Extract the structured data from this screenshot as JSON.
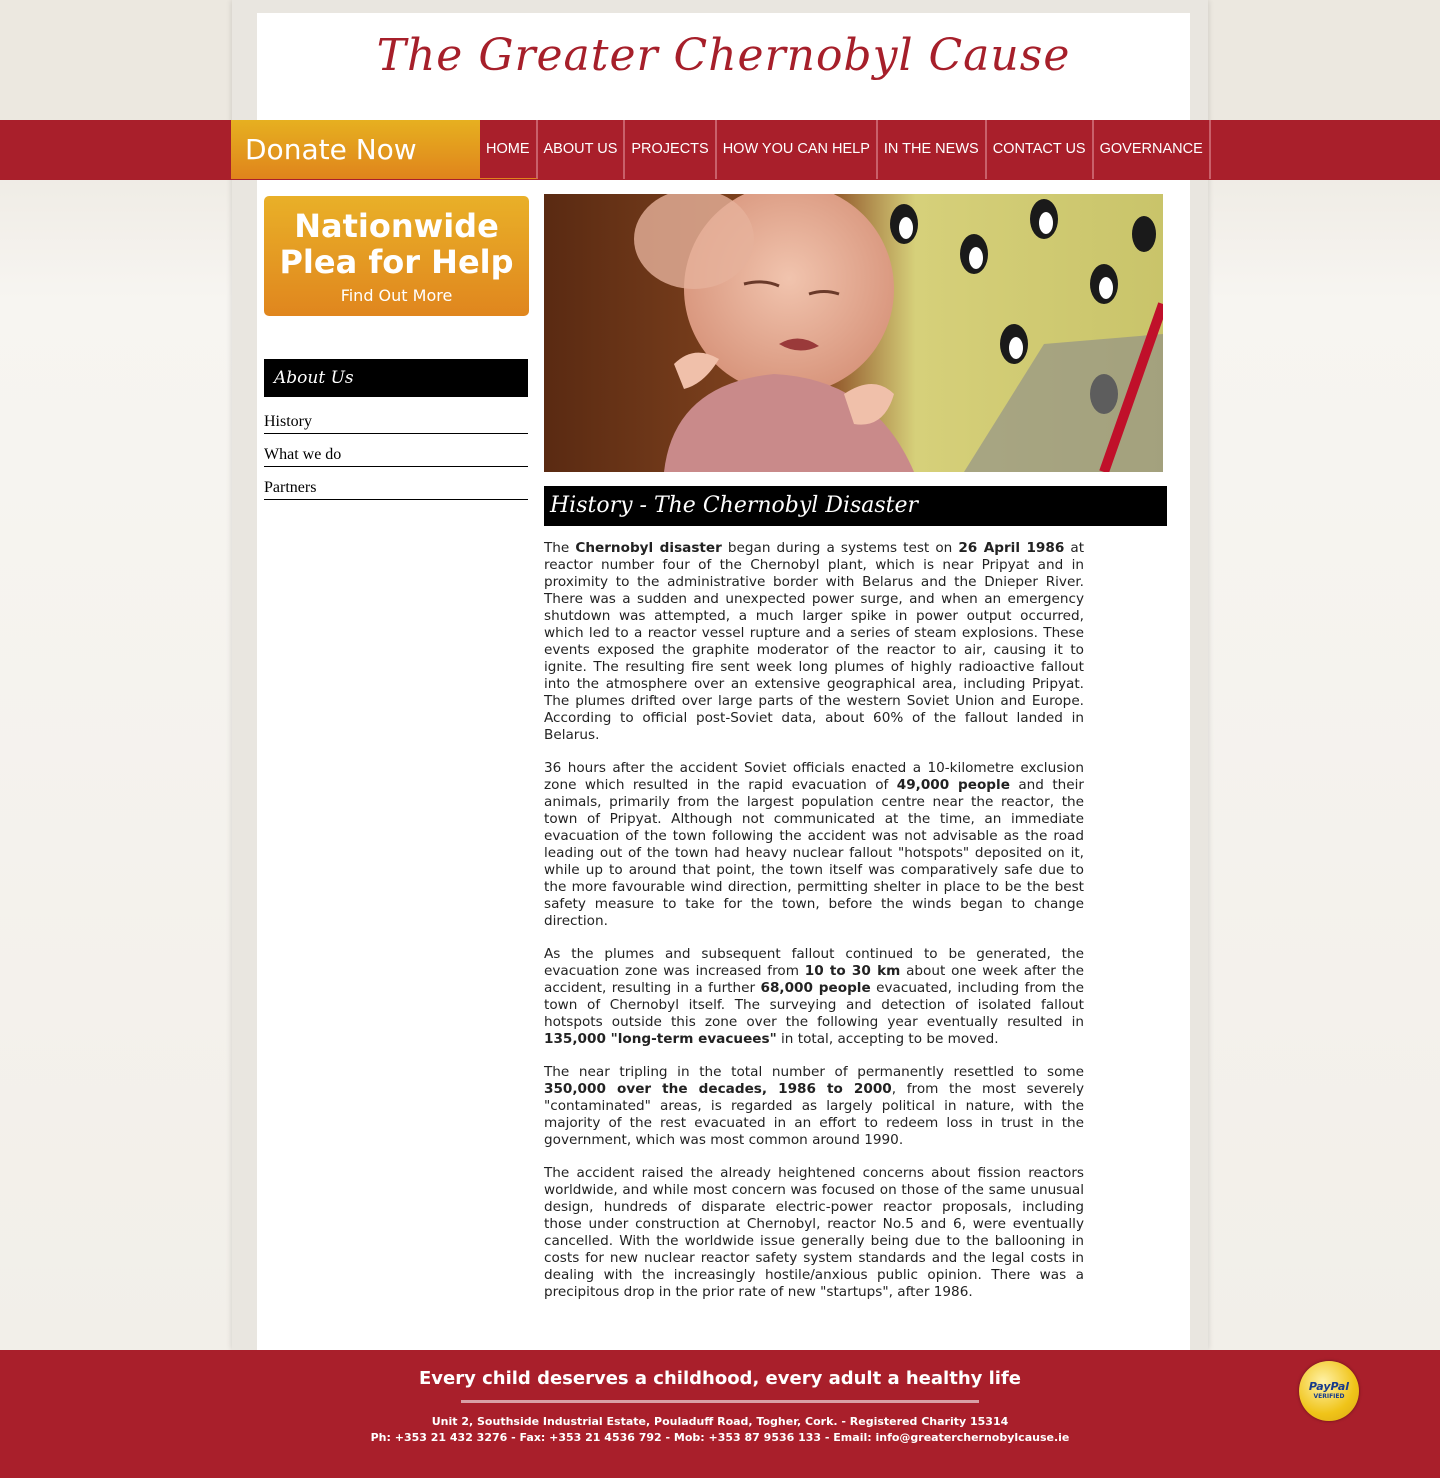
{
  "header": {
    "site_title": "The Greater Chernobyl Cause"
  },
  "nav": {
    "donate_label": "Donate Now",
    "items": [
      {
        "label": "HOME"
      },
      {
        "label": "ABOUT US"
      },
      {
        "label": "PROJECTS"
      },
      {
        "label": "HOW YOU CAN HELP"
      },
      {
        "label": "IN THE NEWS"
      },
      {
        "label": "CONTACT US"
      },
      {
        "label": "GOVERNANCE"
      }
    ]
  },
  "promo": {
    "title_line1": "Nationwide",
    "title_line2": "Plea for Help",
    "subtitle": "Find Out More"
  },
  "sidebar": {
    "header": "About Us",
    "links": [
      {
        "label": "History"
      },
      {
        "label": "What we do"
      },
      {
        "label": "Partners"
      }
    ]
  },
  "main": {
    "section_title": "History - The Chernobyl Disaster",
    "p1": {
      "a": "The ",
      "b1": "Chernobyl disaster",
      "c": " began during a systems test on ",
      "b2": "26 April 1986",
      "d": " at reactor number four of the Chernobyl plant, which is near Pripyat and in proximity to the administrative border with Belarus and the Dnieper River. There was a sudden and unexpected power surge, and when an emergency shutdown was attempted, a much larger spike in power output occurred, which led to a reactor vessel rupture and a series of steam explosions. These events exposed the graphite moderator of the reactor to air, causing it to ignite. The resulting fire sent week long plumes of highly radioactive fallout into the atmosphere over an extensive geographical area, including Pripyat. The plumes drifted over large parts of the western Soviet Union and Europe. According to official post-Soviet data, about 60% of the fallout landed in Belarus."
    },
    "p2": {
      "a": "36 hours after the accident Soviet officials enacted a 10-kilometre exclusion zone which resulted in the rapid evacuation of ",
      "b1": "49,000 people",
      "c": " and their animals, primarily from the largest population centre near the reactor, the town of Pripyat. Although not communicated at the time, an immediate evacuation of the town following the accident was not advisable as the road leading out of the town had heavy nuclear fallout \"hotspots\" deposited on it, while up to around that point, the town itself was comparatively safe due to the more favourable wind direction, permitting shelter in place to be the best safety measure to take for the town, before the winds began to change direction."
    },
    "p3": {
      "a": "As the plumes and subsequent fallout continued to be generated, the evacuation zone was increased from ",
      "b1": "10 to 30 km",
      "c": " about one week after the accident, resulting in a further ",
      "b2": "68,000 people",
      "d": " evacuated, including from the town of Chernobyl itself. The surveying and detection of isolated fallout hotspots outside this zone over the following year eventually resulted in ",
      "b3": "135,000 \"long-term evacuees\"",
      "e": " in total, accepting to be moved."
    },
    "p4": {
      "a": "The near tripling in the total number of permanently resettled to some ",
      "b1": "350,000 over the decades, 1986 to 2000",
      "c": ", from the most severely \"contaminated\" areas, is regarded as largely political in nature, with the majority of the rest evacuated in an effort to redeem loss in trust in the government, which was most common around 1990."
    },
    "p5": "The accident raised the already heightened concerns about fission reactors worldwide, and while most concern was focused on those of the same unusual design, hundreds of disparate electric-power reactor proposals, including those under construction at Chernobyl, reactor No.5 and 6, were eventually cancelled. With the worldwide issue generally being due to the ballooning in costs for new nuclear reactor safety system standards and the legal costs in dealing with the increasingly hostile/anxious public opinion. There was a precipitous drop in the prior rate of new \"startups\", after 1986."
  },
  "footer": {
    "slogan": "Every child deserves a childhood, every adult a healthy life",
    "address": "Unit 2, Southside Industrial Estate, Pouladuff Road, Togher, Cork. - Registered Charity 15314",
    "contact": "Ph: +353 21 432 3276 - Fax: +353 21 4536 792 - Mob: +353 87 9536 133 - Email: info@greaterchernobylcause.ie",
    "paypal_word": "PayPal",
    "paypal_verified": "VERIFIED"
  },
  "colors": {
    "brand_red": "#a91f2b",
    "donate_orange": "#e0841c",
    "accent_gold": "#e6b020"
  }
}
